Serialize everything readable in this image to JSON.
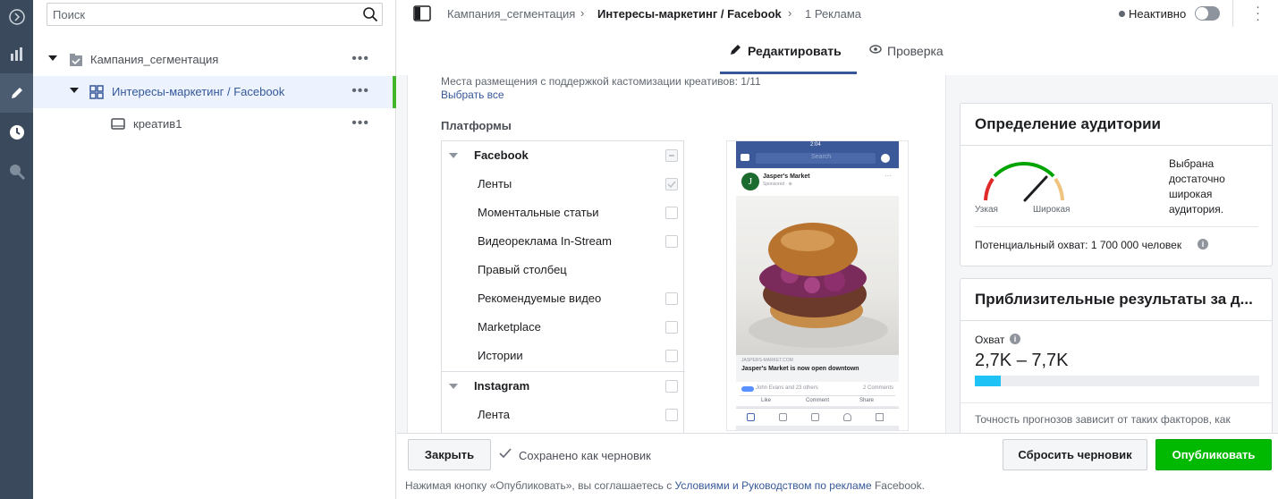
{
  "sidebar_rail": {
    "icons": [
      "expand-icon",
      "chart-icon",
      "pencil-icon",
      "clock-icon",
      "search-analytics-icon"
    ]
  },
  "tree": {
    "search_placeholder": "Поиск",
    "items": [
      {
        "label": "Кампания_сегментация",
        "more": "•••"
      },
      {
        "label": "Интересы-маркетинг / Facebook",
        "more": "•••"
      },
      {
        "label": "креатив1",
        "more": "•••"
      }
    ]
  },
  "topbar": {
    "crumbs": [
      "Кампания_сегментация",
      "Интересы-маркетинг / Facebook",
      "1 Реклама"
    ],
    "status": "Неактивно"
  },
  "tabs": {
    "edit": "Редактировать",
    "review": "Проверка"
  },
  "placements": {
    "info": "Места размещения с поддержкой кастомизации креативов: 1/11",
    "select_all": "Выбрать все",
    "platforms_title": "Платформы",
    "facebook": "Facebook",
    "fb_items": [
      "Ленты",
      "Моментальные статьи",
      "Видеореклама In-Stream",
      "Правый столбец",
      "Рекомендуемые видео",
      "Marketplace",
      "Истории"
    ],
    "instagram": "Instagram",
    "ig_items": [
      "Лента"
    ]
  },
  "preview": {
    "time": "2:04",
    "search": "Search",
    "page": "Jasper's Market",
    "sponsored": "Sponsored · ⊕",
    "domain": "JASPERS-MARKET.COM",
    "headline": "Jasper's Market is now open downtown",
    "reactions": "John Evans and 23 others",
    "comments": "2 Comments",
    "actions": [
      "Like",
      "Comment",
      "Share"
    ]
  },
  "audience": {
    "title": "Определение аудитории",
    "narrow": "Узкая",
    "wide": "Широкая",
    "desc": "Выбрана достаточно широкая аудитория.",
    "reach": "Потенциальный охват: 1 700 000 человек"
  },
  "results": {
    "title": "Приблизительные результаты за д...",
    "reach_label": "Охват",
    "reach_value": "2,7K – 7,7K",
    "reach_fill": 0.09,
    "note": "Точность прогнозов зависит от таких факторов, как"
  },
  "footer": {
    "close": "Закрыть",
    "saved": "Сохранено как черновик",
    "reset": "Сбросить черновик",
    "publish": "Опубликовать",
    "legal_pre": "Нажимая кнопку «Опубликовать», вы соглашаетесь с",
    "legal_link": "Условиями и Руководством по рекламе",
    "legal_post": "Facebook."
  },
  "colors": {
    "accent": "#365899",
    "green": "#00b900",
    "rail": "#3a4a5c"
  }
}
